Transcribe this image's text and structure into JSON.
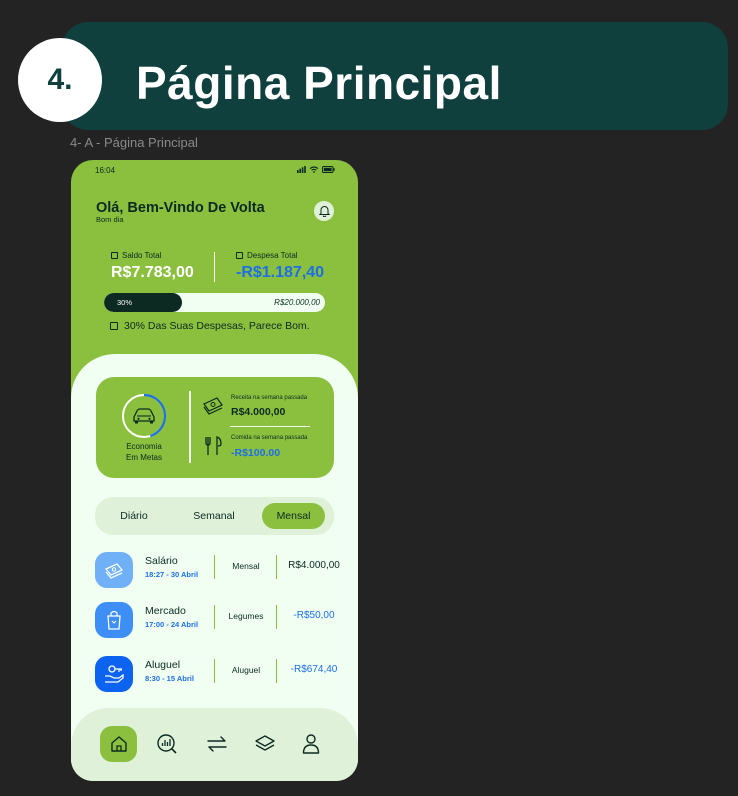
{
  "header": {
    "step": "4.",
    "title": "Página Principal",
    "frame_label": "4- A - Página Principal"
  },
  "colors": {
    "accent_green": "#8bbf3e",
    "dark_teal": "#0f403d",
    "dark_text": "#0d2a22",
    "mint_bg": "#f1fff3",
    "light_mint": "#dff1d8",
    "blue_value": "#1d6fe8"
  },
  "status_bar": {
    "time": "16:04",
    "icons": [
      "signal-icon",
      "wifi-icon",
      "battery-icon"
    ]
  },
  "greeting": {
    "title": "Olá, Bem-Vindo De Volta",
    "subtitle": "Bom dia",
    "bell_icon": "bell-icon"
  },
  "balance": {
    "total_label": "Saldo Total",
    "total_value": "R$7.783,00",
    "expense_label": "Despesa Total",
    "expense_value": "-R$1.187,40"
  },
  "progress": {
    "percent_label": "30%",
    "fraction": 0.3,
    "limit": "R$20.000,00",
    "note": "30% Das Suas Despesas, Parece Bom."
  },
  "goal_card": {
    "goal_label_line1": "Economia",
    "goal_label_line2": "Em Metas",
    "goal_icon": "car-icon",
    "ring_fraction": 0.45,
    "income_caption": "Receita na semana passada",
    "income_value": "R$4.000,00",
    "income_icon": "money-stack-icon",
    "food_caption": "Comida na semana passada",
    "food_value": "-R$100.00",
    "food_icon": "cutlery-icon"
  },
  "tabs": {
    "daily": "Diário",
    "weekly": "Semanal",
    "monthly": "Mensal",
    "active": "monthly"
  },
  "transactions": [
    {
      "title": "Salário",
      "time": "18:27 - 30 Abril",
      "category": "Mensal",
      "amount": "R$4.000,00",
      "icon": "money-icon",
      "icon_bg": "#6fb0f6",
      "amount_color": "#0d2a22"
    },
    {
      "title": "Mercado",
      "time": "17:00 - 24 Abril",
      "category": "Legumes",
      "amount": "-R$50,00",
      "icon": "grocery-bag-icon",
      "icon_bg": "#3d8ef5",
      "amount_color": "#1d6fe8"
    },
    {
      "title": "Aluguel",
      "time": "8:30 - 15 Abril",
      "category": "Aluguel",
      "amount": "-R$674,40",
      "icon": "key-hand-icon",
      "icon_bg": "#0b63ef",
      "amount_color": "#1d6fe8"
    }
  ],
  "navbar": {
    "items": [
      "home-icon",
      "analysis-icon",
      "transfer-icon",
      "layers-icon",
      "profile-icon"
    ],
    "active": "home-icon"
  }
}
